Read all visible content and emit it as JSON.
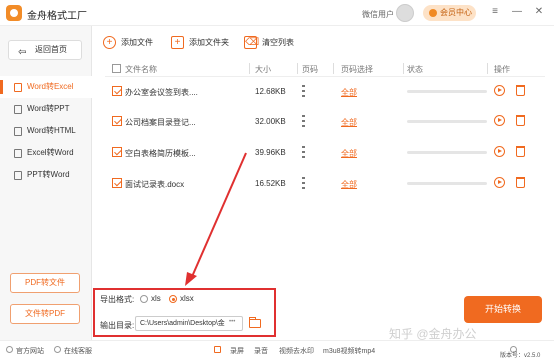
{
  "app": {
    "title": "金舟格式工厂"
  },
  "header": {
    "user_label": "微信用户",
    "member_center": "会员中心"
  },
  "sidebar": {
    "home": "返回首页",
    "items": [
      {
        "label": "Word转Excel",
        "active": true
      },
      {
        "label": "Word转PPT",
        "active": false
      },
      {
        "label": "Word转HTML",
        "active": false
      },
      {
        "label": "Excel转Word",
        "active": false
      },
      {
        "label": "PPT转Word",
        "active": false
      }
    ],
    "bottom_buttons": [
      "PDF转文件",
      "文件转PDF"
    ]
  },
  "toolbar": {
    "add_file": "添加文件",
    "add_folder": "添加文件夹",
    "clear_list": "清空列表"
  },
  "table": {
    "columns": [
      "文件名称",
      "大小",
      "页码",
      "页码选择",
      "状态",
      "操作"
    ],
    "rows": [
      {
        "name": "办公室会议签到表....",
        "size": "12.68KB",
        "page_select": "全部",
        "progress": 0
      },
      {
        "name": "公司档案目录登记...",
        "size": "32.00KB",
        "page_select": "全部",
        "progress": 0
      },
      {
        "name": "空白表格简历模板...",
        "size": "39.96KB",
        "page_select": "全部",
        "progress": 0
      },
      {
        "name": "面试记录表.docx",
        "size": "16.52KB",
        "page_select": "全部",
        "progress": 0
      }
    ]
  },
  "export": {
    "format_label": "导出格式:",
    "options": [
      {
        "label": "xls",
        "selected": false
      },
      {
        "label": "xlsx",
        "selected": true
      }
    ],
    "output_label": "输出目录:",
    "output_path": "C:\\Users\\admin\\Desktop\\金",
    "more": "•••"
  },
  "start_button": "开始转换",
  "watermark": "知乎 @金舟办公",
  "footer": {
    "official_site": "官方网站",
    "online_service": "在线客服",
    "screen_record": "录屏",
    "record_audio": "录音",
    "remove_watermark": "视频去水印",
    "m3u8_to_mp4": "m3u8视频转mp4",
    "version": "版本号：v2.5.0"
  },
  "colors": {
    "accent": "#f06a20",
    "highlight_box": "#e03030"
  }
}
